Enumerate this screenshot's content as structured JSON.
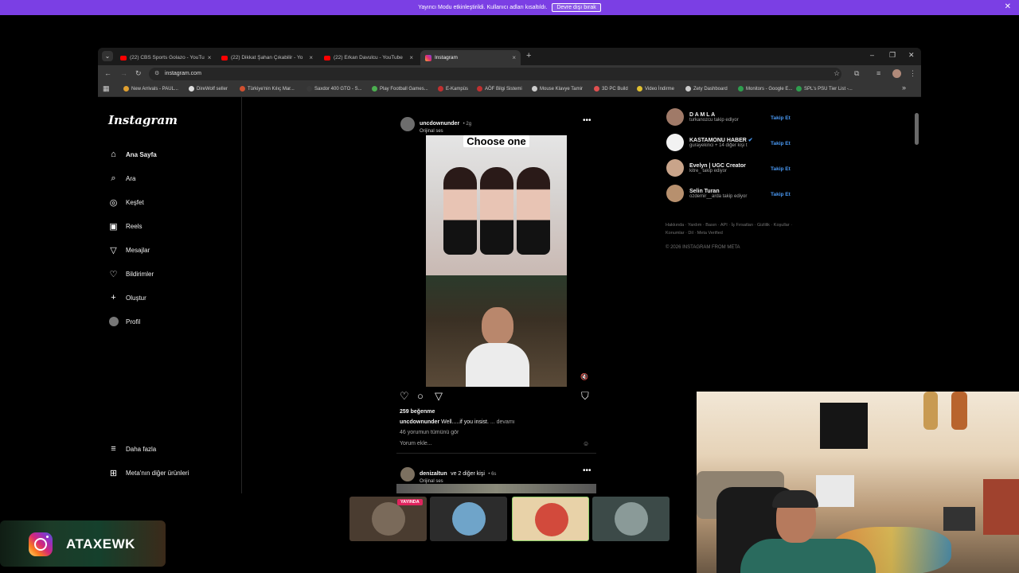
{
  "banner": {
    "text": "Yayıncı Modu etkinleştirildi. Kullanıcı adları kısaltıldı.",
    "button": "Devre dışı bırak",
    "close": "✕"
  },
  "browser": {
    "tabs": [
      {
        "label": "(22) CBS Sports Golazo - YouTu",
        "fav": "youtube-icon"
      },
      {
        "label": "(22) Dikkat Şahan Çıkabilir - Yo",
        "fav": "youtube-icon"
      },
      {
        "label": "(22) Erkan Davulcu - YouTube",
        "fav": "youtube-icon"
      },
      {
        "label": "Instagram",
        "fav": "instagram-icon"
      }
    ],
    "url": "instagram.com",
    "bookmarks": [
      {
        "label": "New Arrivals - PAUL...",
        "color": "#e0a030"
      },
      {
        "label": "DireWolf seller",
        "color": "#dddddd"
      },
      {
        "label": "Türkiye'nin Kılıç Mar...",
        "color": "#d05030"
      },
      {
        "label": "Saxdor 400 GTO - S...",
        "color": "#3a3a3a"
      },
      {
        "label": "Play Football Games...",
        "color": "#4caf50"
      },
      {
        "label": "E-Kampüs",
        "color": "#c03030"
      },
      {
        "label": "AÖF Bilgi Sistemi",
        "color": "#c03030"
      },
      {
        "label": "Mouse Klavye Tamir",
        "color": "#cccccc"
      },
      {
        "label": "3D PC Build",
        "color": "#e05050"
      },
      {
        "label": "Video İndirme",
        "color": "#e0c030"
      },
      {
        "label": "Zety Dashboard",
        "color": "#cccccc"
      },
      {
        "label": "Monitors - Google E...",
        "color": "#2e9e4e"
      },
      {
        "label": "SPL's PSU Tier List -...",
        "color": "#2e9e4e"
      }
    ]
  },
  "instagram": {
    "logo": "Instagram",
    "nav": [
      {
        "label": "Ana Sayfa",
        "icon": "home-icon"
      },
      {
        "label": "Ara",
        "icon": "search-icon"
      },
      {
        "label": "Keşfet",
        "icon": "compass-icon"
      },
      {
        "label": "Reels",
        "icon": "reels-icon"
      },
      {
        "label": "Mesajlar",
        "icon": "send-icon"
      },
      {
        "label": "Bildirimler",
        "icon": "heart-icon"
      },
      {
        "label": "Oluştur",
        "icon": "plus-icon"
      },
      {
        "label": "Profil",
        "icon": "avatar"
      }
    ],
    "more": "Daha fazla",
    "meta": "Meta'nın diğer ürünleri",
    "post": {
      "user": "uncdownunder",
      "time": "• 2g",
      "audio": "Orijinal ses",
      "overlay_text": "Choose one",
      "likes": "259 beğenme",
      "caption_user": "uncdownunder",
      "caption": "Well.....if you insist.",
      "more": "... devamı",
      "comments": "46 yorumun tümünü gör",
      "add_comment": "Yorum ekle..."
    },
    "next_post": {
      "user": "denizaltun",
      "with": "ve 2 diğer kişi",
      "time": "• 6s",
      "audio": "Orijinal ses"
    },
    "suggestions": [
      {
        "name": "D A M L A",
        "sub": "turkanozcu takip ediyor",
        "follow": "Takip Et"
      },
      {
        "name": "KASTAMONU HABER",
        "sub": "gurayekinci + 14 diğer kişi t",
        "follow": "Takip Et"
      },
      {
        "name": "Evelyn | UGC Creator",
        "sub": "kitre_ takip ediyor",
        "follow": "Takip Et"
      },
      {
        "name": "Selin Turan",
        "sub": "ozdemir__arda takip ediyor",
        "follow": "Takip Et"
      }
    ],
    "footer": "Hakkında · Yardım · Basın · API · İş Fırsatları · Gizlilik · Koşullar · Konumlar · Dil · Meta Verified",
    "copyright": "© 2026 INSTAGRAM FROM META"
  },
  "overlay": {
    "live_badge": "YAYINDA",
    "brand_name": "ATAXEWK"
  }
}
